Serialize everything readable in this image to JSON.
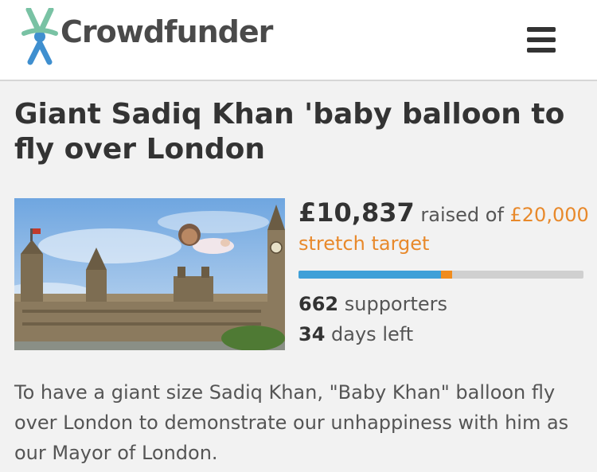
{
  "header": {
    "logo_text": "Crowdfunder",
    "menu_icon": "hamburger-menu-icon"
  },
  "campaign": {
    "title": "Giant Sadiq Khan 'baby balloon to fly over London",
    "image_alt": "Houses of Parliament with baby balloon",
    "amount_raised": "£10,837",
    "raised_of_text": " raised of ",
    "target_amount": "£20,000",
    "stretch_text": "stretch target",
    "progress_fraction": 0.54,
    "supporters_count": "662",
    "supporters_label": " supporters",
    "days_count": "34",
    "days_label": " days left",
    "description": "To have a giant size Sadiq Khan, \"Baby Khan\" balloon fly over London to demonstrate our unhappiness with him as our Mayor of London."
  },
  "colors": {
    "accent_orange": "#e8892b",
    "progress_blue": "#3fa0d8",
    "progress_track": "#d0d0d0",
    "logo_green": "#79c2a4",
    "logo_blue": "#3f8fcf"
  }
}
